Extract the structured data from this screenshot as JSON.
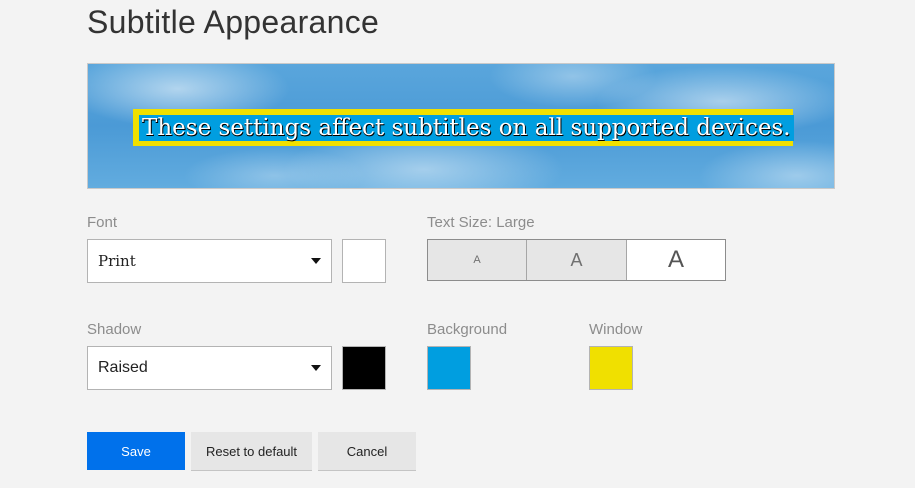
{
  "title": "Subtitle Appearance",
  "preview": {
    "text": "These settings affect subtitles on all supported devices."
  },
  "font": {
    "label": "Font",
    "value": "Print",
    "color": "#ffffff"
  },
  "text_size": {
    "label": "Text Size: Large",
    "options": [
      "A",
      "A",
      "A"
    ],
    "selected": "Large"
  },
  "shadow": {
    "label": "Shadow",
    "value": "Raised",
    "color": "#000000"
  },
  "background": {
    "label": "Background",
    "color": "#009ee0"
  },
  "window": {
    "label": "Window",
    "color": "#f0e000"
  },
  "buttons": {
    "save": "Save",
    "reset": "Reset to default",
    "cancel": "Cancel"
  }
}
